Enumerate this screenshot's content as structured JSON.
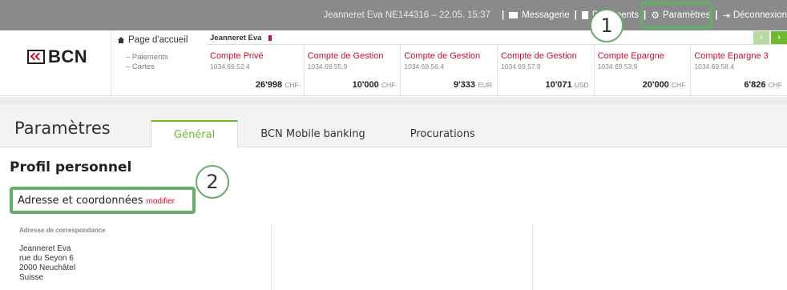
{
  "topbar": {
    "user_info": "Jeanneret Eva   NE144316 – 22.05. 15:37",
    "sep": "|",
    "messages_label": "Messagerie",
    "documents_label": "Documents",
    "settings_label": "Paramètres",
    "logout_label": "Déconnexion"
  },
  "header": {
    "logo_text": "BCN",
    "home_label": "Page d'accueil",
    "sub_links": [
      "– Paiements",
      "– Cartes"
    ]
  },
  "accounts": {
    "owner": "Jeanneret Eva",
    "prev_label": "‹",
    "next_label": "›",
    "items": [
      {
        "name": "Compte Privé",
        "number": "1034.69.52.4",
        "balance": "26'998",
        "currency": "CHF"
      },
      {
        "name": "Compte de Gestion",
        "number": "1034.69.55.9",
        "balance": "10'000",
        "currency": "CHF"
      },
      {
        "name": "Compte de Gestion",
        "number": "1034.69.56.4",
        "balance": "9'333",
        "currency": "EUR"
      },
      {
        "name": "Compte de Gestion",
        "number": "1034.69.57.9",
        "balance": "10'071",
        "currency": "USD"
      },
      {
        "name": "Compte Epargne",
        "number": "1034.69.53.9",
        "balance": "20'000",
        "currency": "CHF"
      },
      {
        "name": "Compte Epargne 3",
        "number": "1034.69.58.4",
        "balance": "6'826",
        "currency": "CHF"
      }
    ]
  },
  "page": {
    "title": "Paramètres",
    "tabs": [
      {
        "label": "Général",
        "active": true
      },
      {
        "label": "BCN Mobile banking",
        "active": false
      },
      {
        "label": "Procurations",
        "active": false
      }
    ]
  },
  "profile": {
    "section_title": "Profil personnel",
    "subhead": "Adresse et coordonnées",
    "modify_link": "modifier",
    "address_label": "Adresse de correspondance",
    "address_lines": [
      "Jeanneret Eva",
      "rue du Seyon 6",
      "2000 Neuchâtel",
      "Suisse"
    ]
  },
  "callouts": [
    "1",
    "2"
  ],
  "colors": {
    "accent": "#6fba2c",
    "brand": "#c8102e",
    "callout": "#6aaa6b"
  }
}
